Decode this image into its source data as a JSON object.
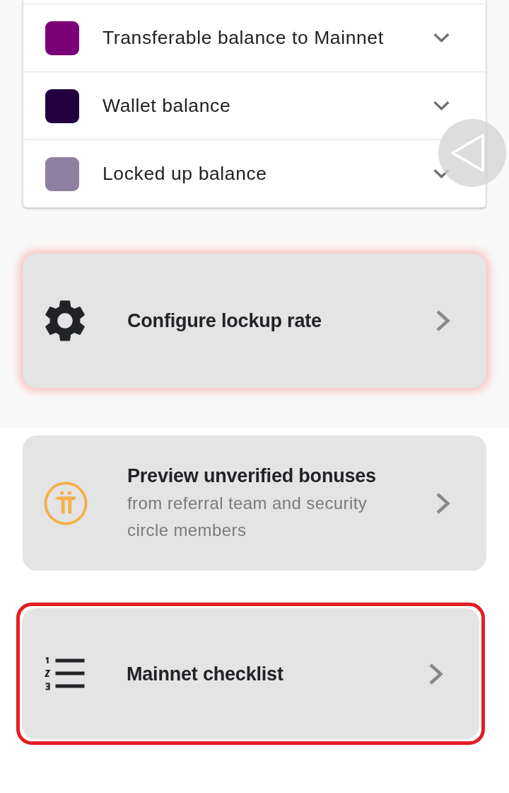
{
  "balances": [
    {
      "label": "Transferable balance to Mainnet",
      "color": "#7b0078",
      "expanded": false
    },
    {
      "label": "Wallet balance",
      "color": "#22003f",
      "expanded": false
    },
    {
      "label": "Locked up balance",
      "color": "#8f7fa0",
      "expanded": false
    }
  ],
  "cards": [
    {
      "kind": "settings",
      "title": "Configure lockup rate",
      "glow": true,
      "outlined": false
    },
    {
      "kind": "bonus",
      "title": "Preview unverified bonuses",
      "subtitle": "from referral team and security circle members",
      "glow": false,
      "outlined": false
    },
    {
      "kind": "checklist",
      "title": "Mainnet checklist",
      "glow": false,
      "outlined": true
    }
  ]
}
